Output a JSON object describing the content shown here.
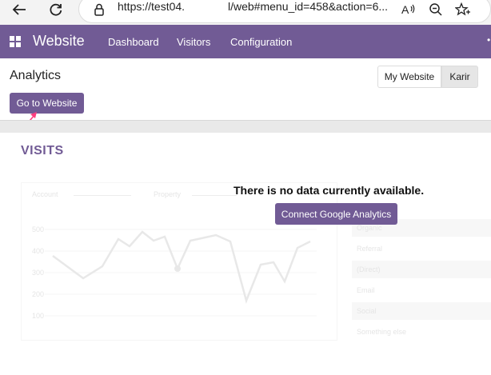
{
  "browser": {
    "url_visible_start": "https://test04.",
    "url_visible_end": "l/web#menu_id=458&action=6..."
  },
  "navbar": {
    "brand": "Website",
    "items": [
      "Dashboard",
      "Visitors",
      "Configuration"
    ]
  },
  "control_panel": {
    "title": "Analytics",
    "go_to_website_label": "Go to Website",
    "website_switch": [
      "My Website",
      "Karir"
    ]
  },
  "section": {
    "heading": "VISITS",
    "empty_message": "There is no data currently available.",
    "connect_label": "Connect Google Analytics"
  },
  "placeholder_dashboard": {
    "filters": [
      "Account",
      "Property"
    ],
    "y_ticks": [
      "500",
      "400",
      "300",
      "200",
      "100"
    ],
    "table_rows": [
      "Organic",
      "Referral",
      "(Direct)",
      "Email",
      "Social",
      "Something else"
    ]
  },
  "colors": {
    "brand": "#715b95",
    "annotation_arrow": "#ff3d7f"
  },
  "icons": [
    "back-arrow-icon",
    "reload-icon",
    "lock-icon",
    "read-aloud-icon",
    "zoom-out-icon",
    "favorite-add-icon",
    "apps-grid-icon"
  ]
}
